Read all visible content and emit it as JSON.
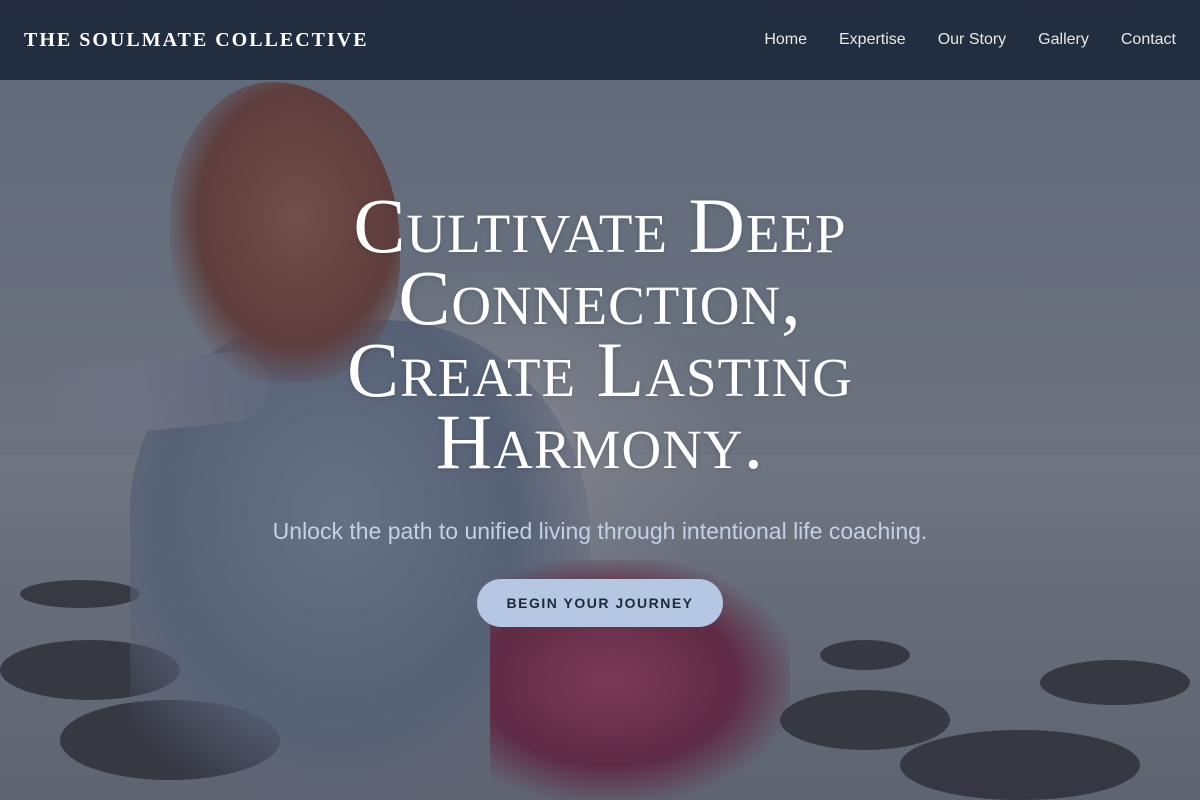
{
  "header": {
    "brand": "THE SOULMATE COLLECTIVE",
    "nav": [
      {
        "label": "Home"
      },
      {
        "label": "Expertise"
      },
      {
        "label": "Our Story"
      },
      {
        "label": "Gallery"
      },
      {
        "label": "Contact"
      }
    ]
  },
  "hero": {
    "headline": "Cultivate Deep Connection, Create Lasting Harmony.",
    "subheadline": "Unlock the path to unified living through intentional life coaching.",
    "cta_label": "BEGIN YOUR JOURNEY",
    "background_image": "woman-arms-outstretched-by-rocky-sea"
  },
  "colors": {
    "navbar_bg": "#1e293b",
    "cta_bg": "#b5c7e3",
    "cta_text": "#1e293b",
    "subheadline_text": "#c3d0e6"
  }
}
